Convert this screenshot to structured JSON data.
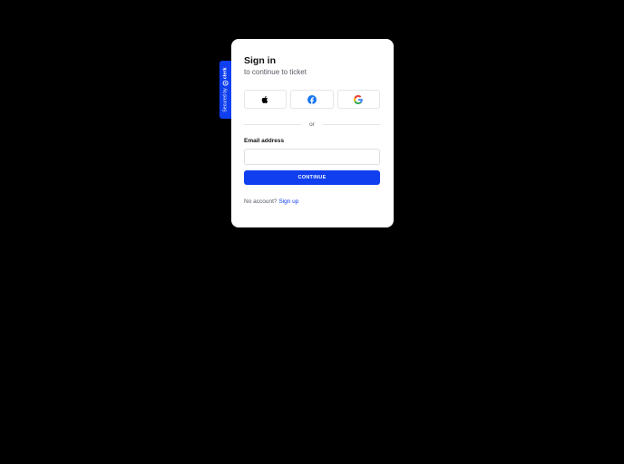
{
  "badge": {
    "text": "Secured by",
    "brand": "clerk"
  },
  "card": {
    "title": "Sign in",
    "subtitle": "to continue to ticket",
    "social": [
      {
        "icon": "apple-icon"
      },
      {
        "icon": "facebook-icon"
      },
      {
        "icon": "google-icon"
      }
    ],
    "divider_text": "or",
    "email_label": "Email address",
    "email_value": "",
    "continue_label": "CONTINUE",
    "footer_text": "No account?",
    "signup_label": "Sign up"
  },
  "colors": {
    "accent": "#103FEF",
    "background": "#000000",
    "card": "#ffffff",
    "facebook": "#1877F2"
  }
}
